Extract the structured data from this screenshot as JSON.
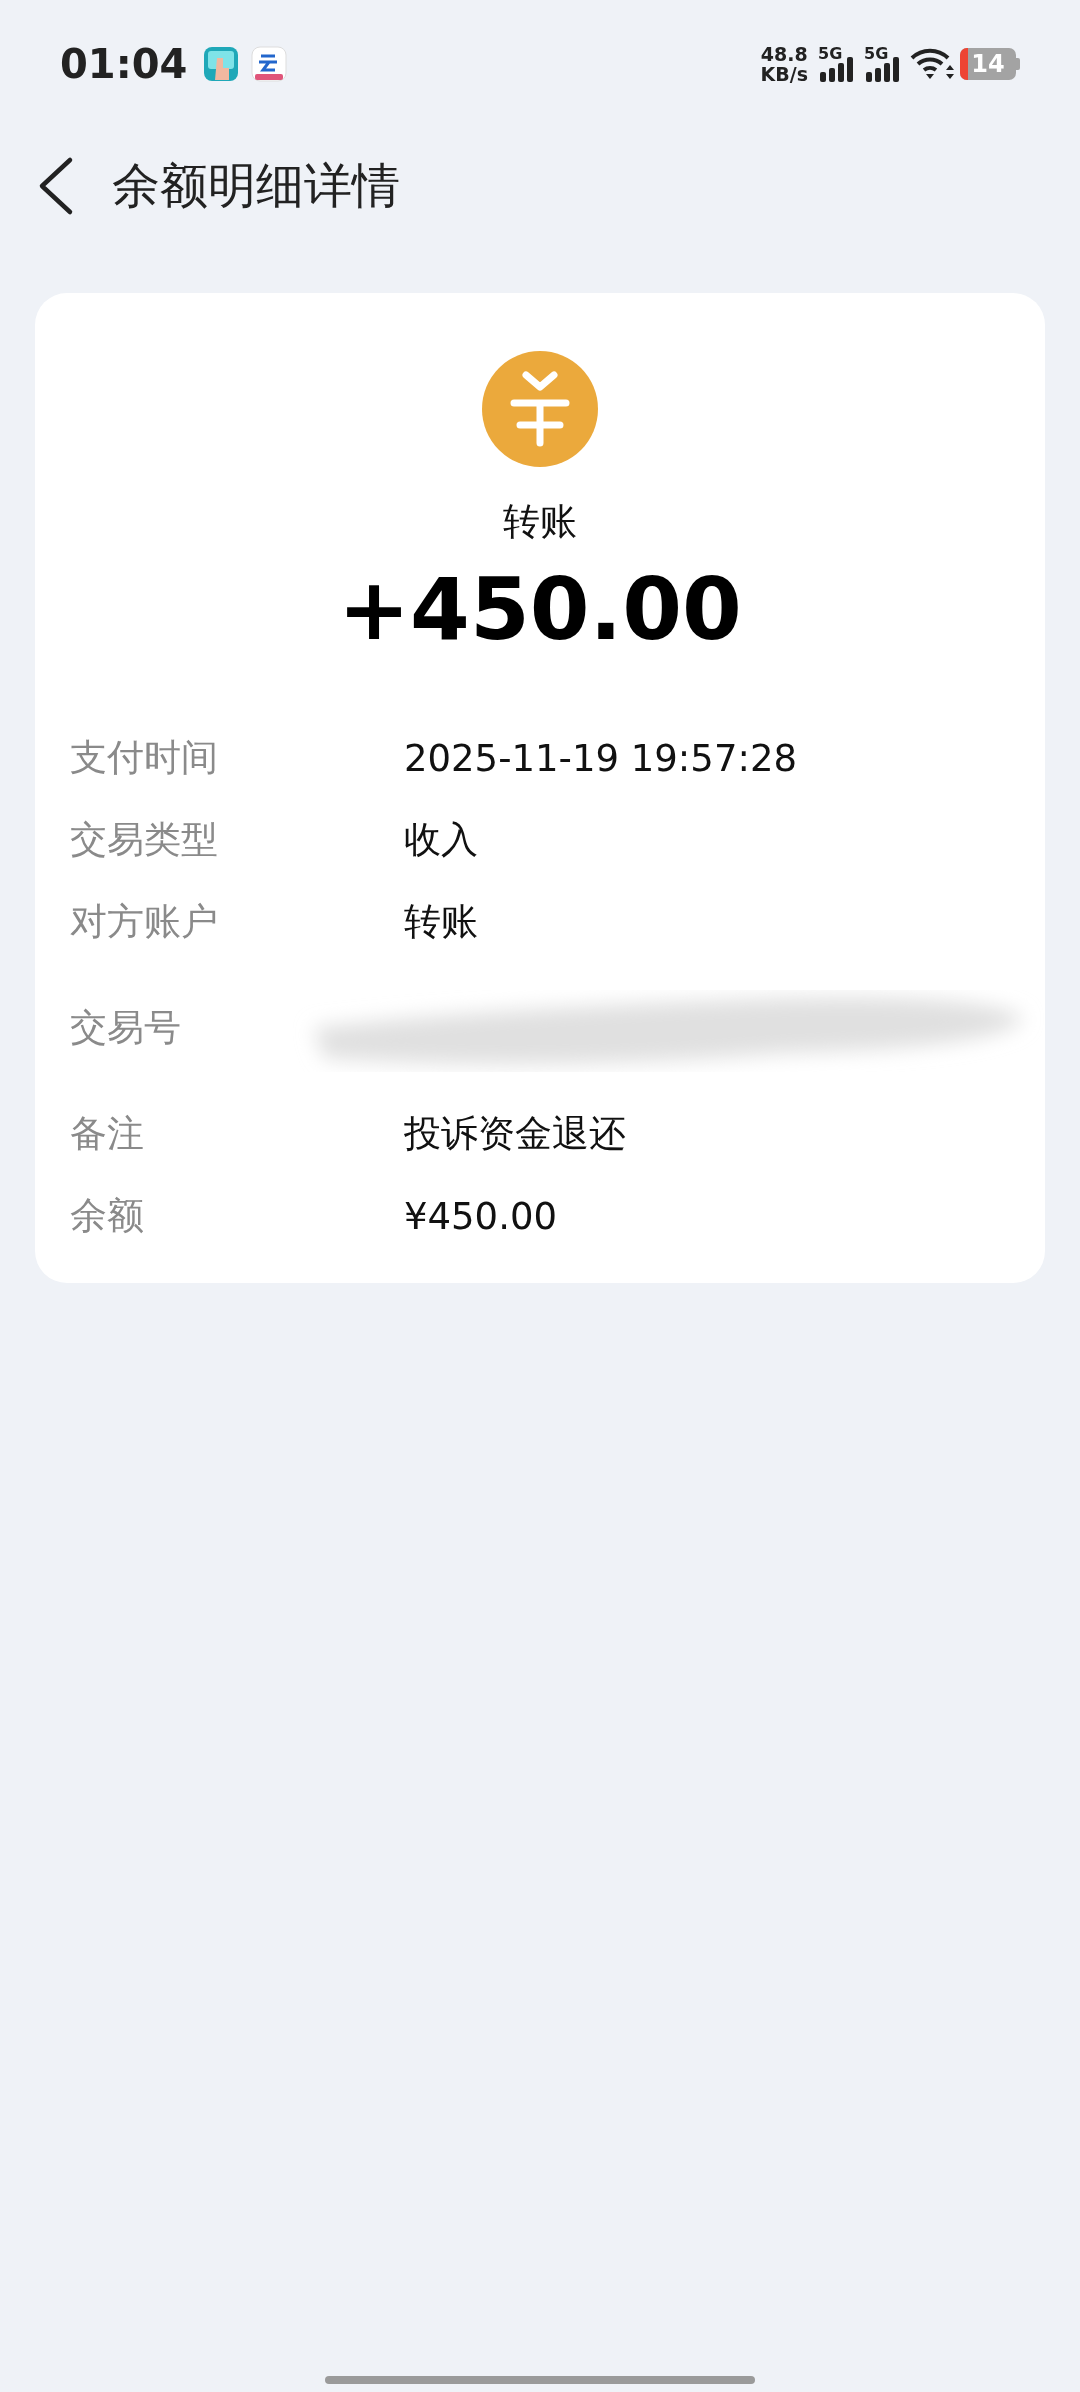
{
  "status_bar": {
    "time": "01:04",
    "speed_value": "48.8",
    "speed_unit": "KB/s",
    "signals": [
      {
        "label": "5G"
      },
      {
        "label": "5G"
      }
    ],
    "battery": "14"
  },
  "header": {
    "title": "余额明细详情"
  },
  "summary": {
    "category": "转账",
    "amount": "+450.00"
  },
  "details": [
    {
      "label": "支付时间",
      "value": "2025-11-19 19:57:28"
    },
    {
      "label": "交易类型",
      "value": "收入"
    },
    {
      "label": "对方账户",
      "value": "转账"
    },
    {
      "label": "交易号",
      "kind": "redacted"
    },
    {
      "label": "备注",
      "value": "投诉资金退还"
    },
    {
      "label": "余额",
      "value": "¥450.00"
    }
  ]
}
